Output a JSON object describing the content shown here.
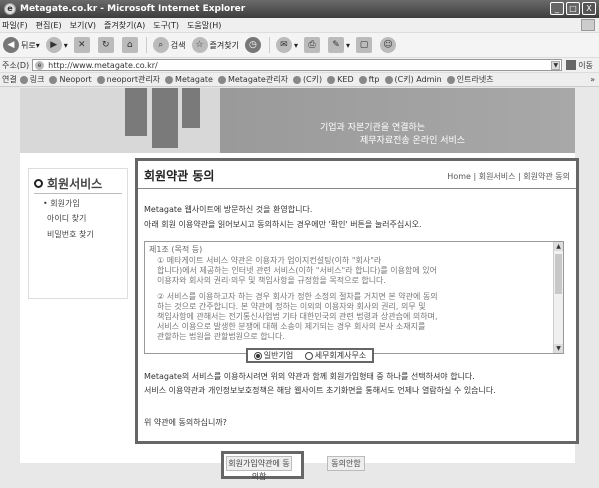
{
  "window": {
    "title": "Metagate.co.kr - Microsoft Internet Explorer",
    "controls": [
      "_",
      "□",
      "X"
    ]
  },
  "menubar": {
    "items": [
      "파일(F)",
      "편집(E)",
      "보기(V)",
      "즐겨찾기(A)",
      "도구(T)",
      "도움말(H)"
    ]
  },
  "toolbar": {
    "back": "뒤로",
    "search": "검색",
    "favorites": "즐겨찾기"
  },
  "addressbar": {
    "label": "주소(D)",
    "url": "http://www.metagate.co.kr/",
    "go": "이동"
  },
  "linksbar": {
    "label": "연결",
    "links": [
      "링크",
      "Neoport",
      "neoport관리자",
      "Metagate",
      "Metagate관리자",
      "(C키)",
      "KED",
      "ftp",
      "(C키) Admin",
      "인트라넷츠"
    ]
  },
  "banner": {
    "line1": "기업과 자본기관을 연결하는",
    "line2": "제무자료전송 온라인 서비스"
  },
  "sidebar": {
    "title": "회원서비스",
    "items": [
      "회원가입",
      "아이디 찾기",
      "비밀번호 찾기"
    ]
  },
  "main": {
    "title": "회원약관 동의",
    "breadcrumb": "Home | 회원서비스 | 회원약관 동의",
    "intro1": "Metagate 웹사이트에 방문하신 것을 환영합니다.",
    "intro2": "아래 회원 이용약관을 읽어보시고 동의하시는 경우에만 '확인' 버튼을 눌러주십시오.",
    "terms_section": "제1조 (목적 등)",
    "terms_p1": "① 메타게이트 서비스 약관은 이용자가 업이지컨설팅(이하 \"회사\"라\n합니다)에서 제공하는 인터넷 관련 서비스(이하 \"서비스\"라 합니다)를 이용함에 있어\n이용자와 회사의 권리·의무 및 책임사항을 규정함을 목적으로 합니다.",
    "terms_p2": "② 서비스를 이용하고자 하는 경우 회사가 정한 소정의 절차를 거치면 본 약관에 동의\n하는 것으로 간주합니다. 본 약관에 정하는 이외의 이용자와 회사의 권리, 의무 및\n책임사항에 관해서는 전기통신사업법 기타 대한민국의 관련 법령과 상관습에 의하며,\n서비스 이용으로 발생한 분쟁에 대해 소송이 제기되는 경우 회사의 본사 소재지를\n관할하는 법원을 관할법원으로 합니다.",
    "radio_company": "일반기업",
    "radio_accounting": "세무회계사무소",
    "note1": "Metagate의 서비스를 이용하시려면 위의 약관과 함께 회원가입형태 중 하나를 선택하셔야 합니다.",
    "note2": "서비스 이용약관과 개인정보보호정책은 해당 웹사이트 초기화면을 통해서도 언제나 열람하실 수 있습니다.",
    "question": "위 약관에 동의하십니까?",
    "agree_button": "회원가입약관에 동의함",
    "disagree_button": "동의안함"
  }
}
